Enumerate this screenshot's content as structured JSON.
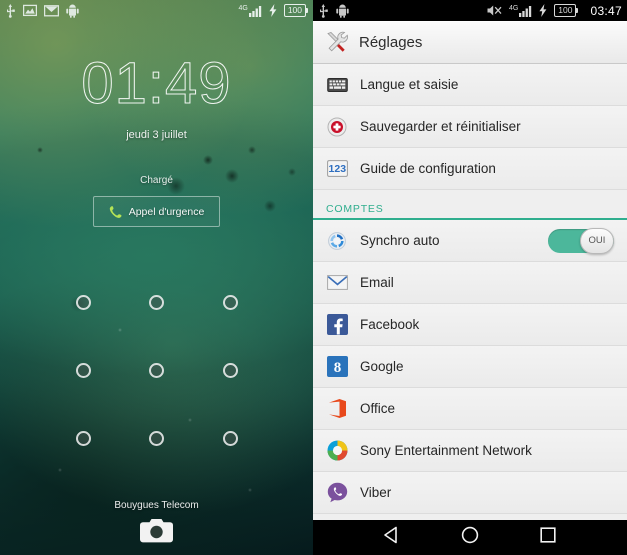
{
  "lockscreen": {
    "statusbar": {
      "icons": [
        "usb-icon",
        "screenshot-icon",
        "email-icon",
        "android-icon"
      ],
      "network_label": "4G",
      "battery_level": "100"
    },
    "clock": "01:49",
    "date": "jeudi 3 juillet",
    "battery_status": "Chargé",
    "emergency_button": "Appel d'urgence",
    "pattern_dots": 9,
    "carrier": "Bouygues Telecom",
    "camera_shortcut": "camera-icon"
  },
  "settings": {
    "statusbar": {
      "icons": [
        "usb-icon",
        "android-icon",
        "mute-icon"
      ],
      "network_label": "4G",
      "battery_level": "100",
      "time": "03:47"
    },
    "header": {
      "icon": "tools-icon",
      "title": "Réglages"
    },
    "items": [
      {
        "label": "Langue et saisie",
        "icon": "keyboard-icon"
      },
      {
        "label": "Sauvegarder et réinitialiser",
        "icon": "backup-reset-icon"
      },
      {
        "label": "Guide de configuration",
        "icon": "setup-guide-icon",
        "icon_text": "123"
      }
    ],
    "section": {
      "label": "COMPTES",
      "accent_color": "#2fae8e"
    },
    "sync": {
      "label": "Synchro auto",
      "icon": "sync-icon",
      "toggle_state": "OUI",
      "toggle_on": true
    },
    "accounts": [
      {
        "label": "Email",
        "icon": "email-icon"
      },
      {
        "label": "Facebook",
        "icon": "facebook-icon",
        "icon_text": "f",
        "color": "#3b5998"
      },
      {
        "label": "Google",
        "icon": "google-icon",
        "icon_text": "8",
        "color": "#2a73bb"
      },
      {
        "label": "Office",
        "icon": "office-icon",
        "color": "#e8491c"
      },
      {
        "label": "Sony Entertainment Network",
        "icon": "sony-entertainment-network-icon"
      },
      {
        "label": "Viber",
        "icon": "viber-icon",
        "color": "#7b519d"
      }
    ],
    "navbar": {
      "back": "back-icon",
      "home": "home-icon",
      "recents": "recents-icon"
    }
  }
}
